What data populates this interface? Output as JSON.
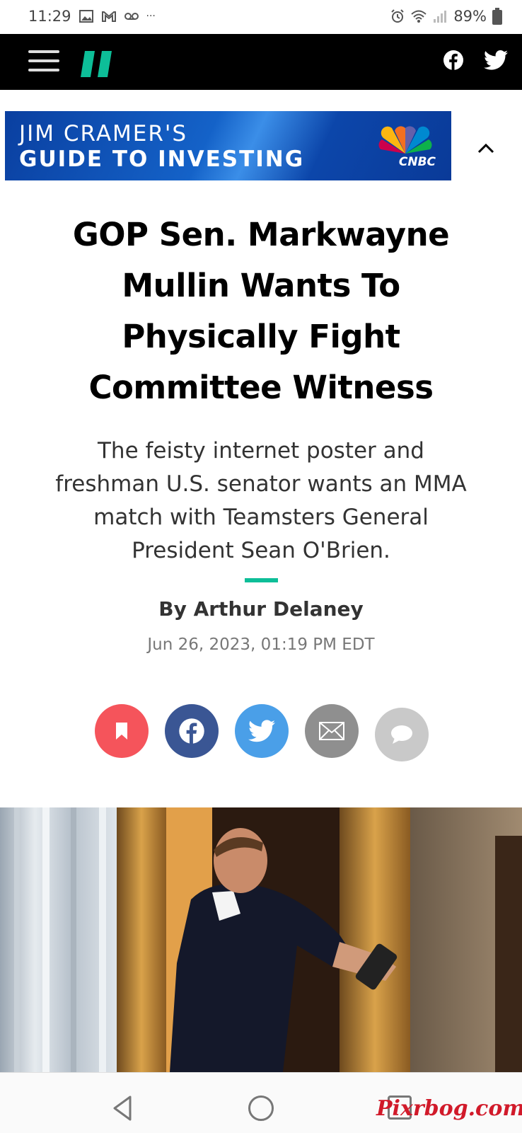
{
  "status_bar": {
    "time": "11:29",
    "more": "···",
    "battery": "89%"
  },
  "ad": {
    "line1": "JIM CRAMER'S",
    "line2": "GUIDE TO INVESTING",
    "brand": "CNBC"
  },
  "article": {
    "headline_lines": [
      "GOP Sen. Markwayne",
      "Mullin Wants To",
      "Physically Fight",
      "Committee Witness"
    ],
    "subhead_lines": [
      "The feisty internet poster and",
      "freshman U.S. senator wants an MMA",
      "match with Teamsters General",
      "President Sean O'Brien."
    ],
    "byline": "By Arthur Delaney",
    "date": "Jun 26, 2023, 01:19 PM EDT"
  },
  "share": {
    "colors": {
      "bookmark": "#f5545b",
      "facebook": "#3a5694",
      "twitter": "#4a9fe8",
      "email": "#8f8f8f",
      "comment": "#c9c9c9"
    }
  },
  "brand_colors": {
    "accent": "#0dbe98",
    "nav_bg": "#000000"
  },
  "watermark": "Pixrbog.com"
}
